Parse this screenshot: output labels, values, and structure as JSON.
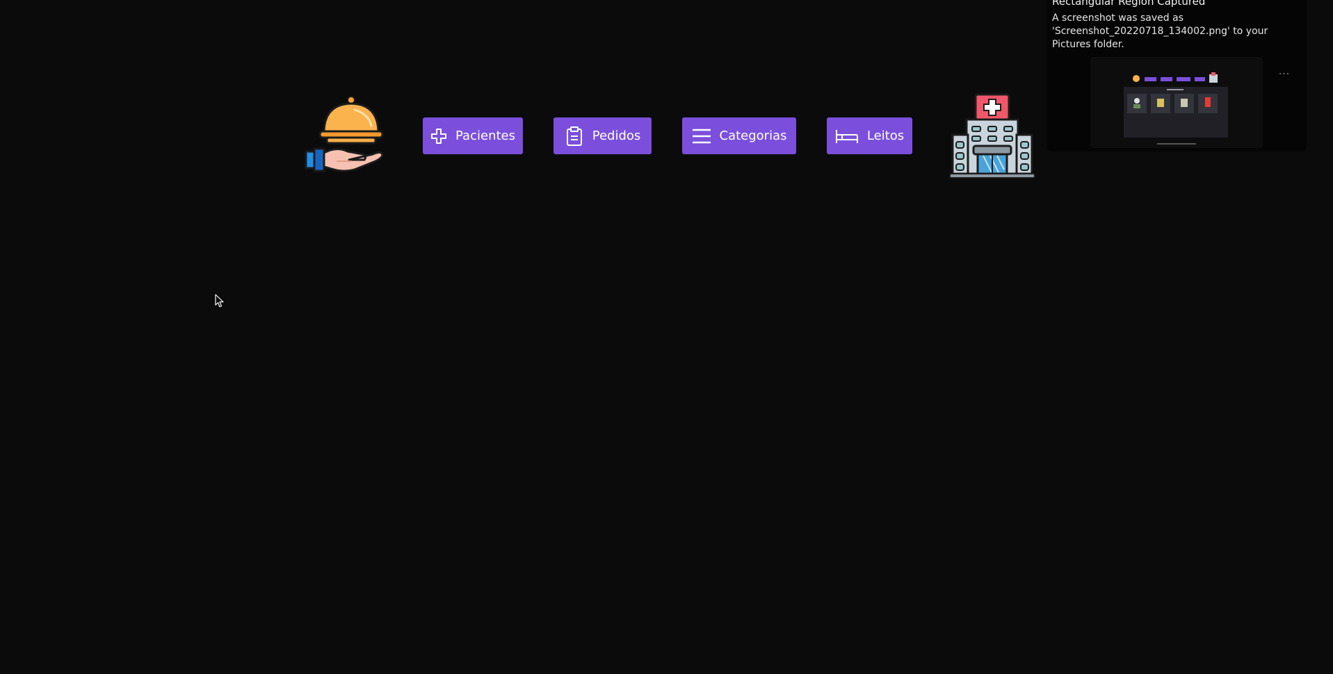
{
  "nav": {
    "buttons": [
      {
        "label": "Pacientes",
        "icon": "plus-icon"
      },
      {
        "label": "Pedidos",
        "icon": "clipboard-icon"
      },
      {
        "label": "Categorias",
        "icon": "menu-icon"
      },
      {
        "label": "Leitos",
        "icon": "bed-icon"
      }
    ],
    "left_logo": "food-service-icon",
    "right_logo": "hospital-icon"
  },
  "notification": {
    "title": "Rectangular Region Captured",
    "body": "A screenshot was saved as 'Screenshot_20220718_134002.png' to your Pictures folder.",
    "menu_glyph": "..."
  },
  "colors": {
    "background": "#0b0b0b",
    "button": "#7b4fdc",
    "button_text": "#ffffff"
  }
}
